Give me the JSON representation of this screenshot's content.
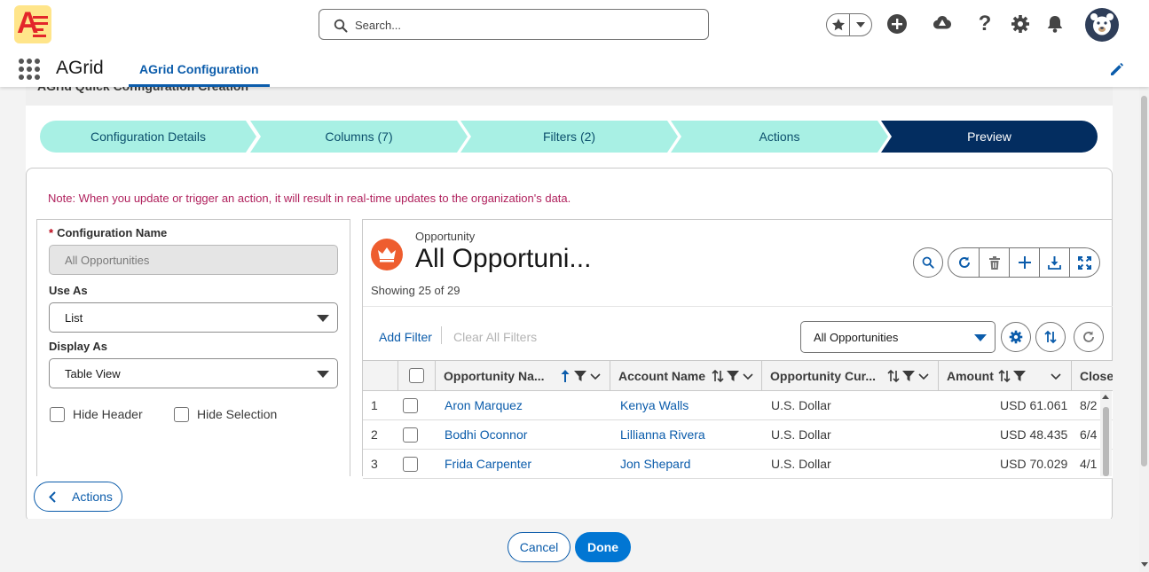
{
  "header": {
    "logo_letter": "A",
    "search_placeholder": "Search...",
    "icons": [
      "star-icon",
      "chevron-down-icon",
      "add-icon",
      "trailhead-icon",
      "help-icon",
      "setup-gear-icon",
      "bell-icon",
      "avatar"
    ]
  },
  "app_nav": {
    "app_name": "AGrid",
    "tab_label": "AGrid Configuration"
  },
  "page": {
    "title": "AGrid Quick Configuration Creation",
    "path_steps": [
      "Configuration Details",
      "Columns (7)",
      "Filters (2)",
      "Actions",
      "Preview"
    ],
    "active_step": "Preview",
    "note": "Note: When you update or trigger an action, it will result in real-time updates to the organization's data."
  },
  "form": {
    "config_name_label": "Configuration Name",
    "required_mark": "*",
    "config_name_value": "All Opportunities",
    "use_as_label": "Use As",
    "use_as_value": "List",
    "display_as_label": "Display As",
    "display_as_value": "Table View",
    "hide_header_label": "Hide Header",
    "hide_selection_label": "Hide Selection"
  },
  "preview": {
    "object_type": "Opportunity",
    "title": "All Opportuni...",
    "showing": "Showing 25 of 29",
    "add_filter": "Add Filter",
    "clear_filters": "Clear All Filters",
    "list_view": "All Opportunities",
    "columns": [
      "Opportunity Na...",
      "Account Name",
      "Opportunity Cur...",
      "Amount",
      "Close"
    ],
    "rows": [
      {
        "n": "1",
        "opportunity": "Aron Marquez",
        "account": "Kenya Walls",
        "currency": "U.S. Dollar",
        "amount": "USD 61.061",
        "close": "8/2"
      },
      {
        "n": "2",
        "opportunity": "Bodhi Oconnor",
        "account": "Lillianna Rivera",
        "currency": "U.S. Dollar",
        "amount": "USD 48.435",
        "close": "6/4"
      },
      {
        "n": "3",
        "opportunity": "Frida Carpenter",
        "account": "Jon Shepard",
        "currency": "U.S. Dollar",
        "amount": "USD 70.029",
        "close": "4/1"
      }
    ]
  },
  "footer": {
    "back_label": "Actions",
    "cancel_label": "Cancel",
    "done_label": "Done"
  },
  "colors": {
    "brand_blue": "#0176d3",
    "link_blue": "#0b5cab",
    "path_complete": "#a8f0e4",
    "path_active": "#032d60",
    "note_pink": "#b0215d",
    "object_icon": "#ee5d2f"
  }
}
